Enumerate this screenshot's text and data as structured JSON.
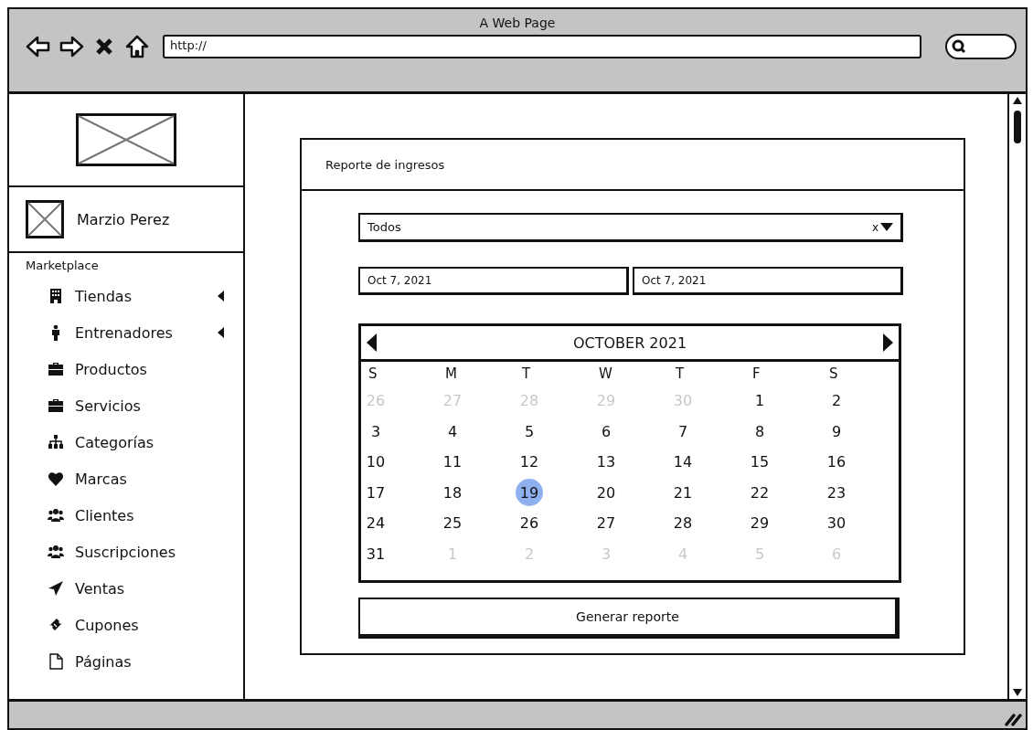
{
  "browser": {
    "title": "A Web Page",
    "url": "http://"
  },
  "sidebar": {
    "user_name": "Marzio Perez",
    "section": "Marketplace",
    "items": [
      {
        "label": "Tiendas",
        "submenu": true
      },
      {
        "label": "Entrenadores",
        "submenu": true
      },
      {
        "label": "Productos",
        "submenu": false
      },
      {
        "label": "Servicios",
        "submenu": false
      },
      {
        "label": "Categorías",
        "submenu": false
      },
      {
        "label": "Marcas",
        "submenu": false
      },
      {
        "label": "Clientes",
        "submenu": false
      },
      {
        "label": "Suscripciones",
        "submenu": false
      },
      {
        "label": "Ventas",
        "submenu": false
      },
      {
        "label": "Cupones",
        "submenu": false
      },
      {
        "label": "Páginas",
        "submenu": false
      }
    ]
  },
  "report": {
    "title": "Reporte de ingresos",
    "filter": {
      "value": "Todos",
      "clear": "x"
    },
    "date_from": "Oct 7, 2021",
    "date_to": "Oct 7, 2021",
    "calendar": {
      "month": "OCTOBER 2021",
      "weekdays": [
        "S",
        "M",
        "T",
        "W",
        "T",
        "F",
        "S"
      ],
      "weeks": [
        [
          {
            "label": "26",
            "outside": true,
            "selected": false
          },
          {
            "label": "27",
            "outside": true,
            "selected": false
          },
          {
            "label": "28",
            "outside": true,
            "selected": false
          },
          {
            "label": "29",
            "outside": true,
            "selected": false
          },
          {
            "label": "30",
            "outside": true,
            "selected": false
          },
          {
            "label": "1",
            "outside": false,
            "selected": false
          },
          {
            "label": "2",
            "outside": false,
            "selected": false
          }
        ],
        [
          {
            "label": "3",
            "outside": false,
            "selected": false
          },
          {
            "label": "4",
            "outside": false,
            "selected": false
          },
          {
            "label": "5",
            "outside": false,
            "selected": false
          },
          {
            "label": "6",
            "outside": false,
            "selected": false
          },
          {
            "label": "7",
            "outside": false,
            "selected": false
          },
          {
            "label": "8",
            "outside": false,
            "selected": false
          },
          {
            "label": "9",
            "outside": false,
            "selected": false
          }
        ],
        [
          {
            "label": "10",
            "outside": false,
            "selected": false
          },
          {
            "label": "11",
            "outside": false,
            "selected": false
          },
          {
            "label": "12",
            "outside": false,
            "selected": false
          },
          {
            "label": "13",
            "outside": false,
            "selected": false
          },
          {
            "label": "14",
            "outside": false,
            "selected": false
          },
          {
            "label": "15",
            "outside": false,
            "selected": false
          },
          {
            "label": "16",
            "outside": false,
            "selected": false
          }
        ],
        [
          {
            "label": "17",
            "outside": false,
            "selected": false
          },
          {
            "label": "18",
            "outside": false,
            "selected": false
          },
          {
            "label": "19",
            "outside": false,
            "selected": true
          },
          {
            "label": "20",
            "outside": false,
            "selected": false
          },
          {
            "label": "21",
            "outside": false,
            "selected": false
          },
          {
            "label": "22",
            "outside": false,
            "selected": false
          },
          {
            "label": "23",
            "outside": false,
            "selected": false
          }
        ],
        [
          {
            "label": "24",
            "outside": false,
            "selected": false
          },
          {
            "label": "25",
            "outside": false,
            "selected": false
          },
          {
            "label": "26",
            "outside": false,
            "selected": false
          },
          {
            "label": "27",
            "outside": false,
            "selected": false
          },
          {
            "label": "28",
            "outside": false,
            "selected": false
          },
          {
            "label": "29",
            "outside": false,
            "selected": false
          },
          {
            "label": "30",
            "outside": false,
            "selected": false
          }
        ],
        [
          {
            "label": "31",
            "outside": false,
            "selected": false
          },
          {
            "label": "1",
            "outside": true,
            "selected": false
          },
          {
            "label": "2",
            "outside": true,
            "selected": false
          },
          {
            "label": "3",
            "outside": true,
            "selected": false
          },
          {
            "label": "4",
            "outside": true,
            "selected": false
          },
          {
            "label": "5",
            "outside": true,
            "selected": false
          },
          {
            "label": "6",
            "outside": true,
            "selected": false
          }
        ]
      ]
    },
    "button": "Generar reporte"
  }
}
